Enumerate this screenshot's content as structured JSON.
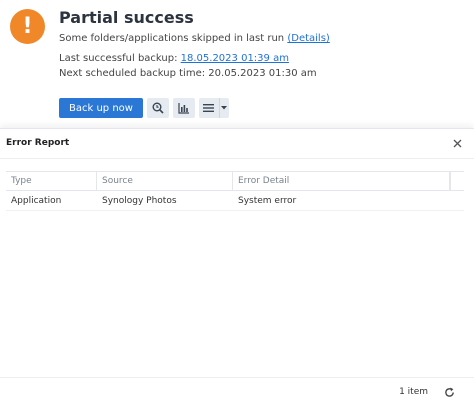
{
  "status": {
    "icon": "exclamation-icon",
    "icon_glyph": "!",
    "title": "Partial success",
    "subtitle_text": "Some folders/applications skipped in last run",
    "details_link": "(Details)",
    "last_backup_label": "Last successful backup:",
    "last_backup_value": "18.05.2023 01:39 am",
    "next_backup_label": "Next scheduled backup time:",
    "next_backup_value": "20.05.2023 01:30 am",
    "accent_color": "#f0882a"
  },
  "toolbar": {
    "backup_now_label": "Back up now",
    "icons": [
      "version-search-icon",
      "statistics-icon",
      "menu-icon",
      "caret-down-icon"
    ],
    "primary_color": "#2b77d6"
  },
  "dialog": {
    "title": "Error Report",
    "close_icon": "close-icon",
    "columns": [
      "Type",
      "Source",
      "Error Detail"
    ],
    "rows": [
      {
        "type": "Application",
        "source": "Synology Photos",
        "detail": "System error"
      }
    ],
    "item_count": "1 item",
    "refresh_icon": "refresh-icon"
  }
}
